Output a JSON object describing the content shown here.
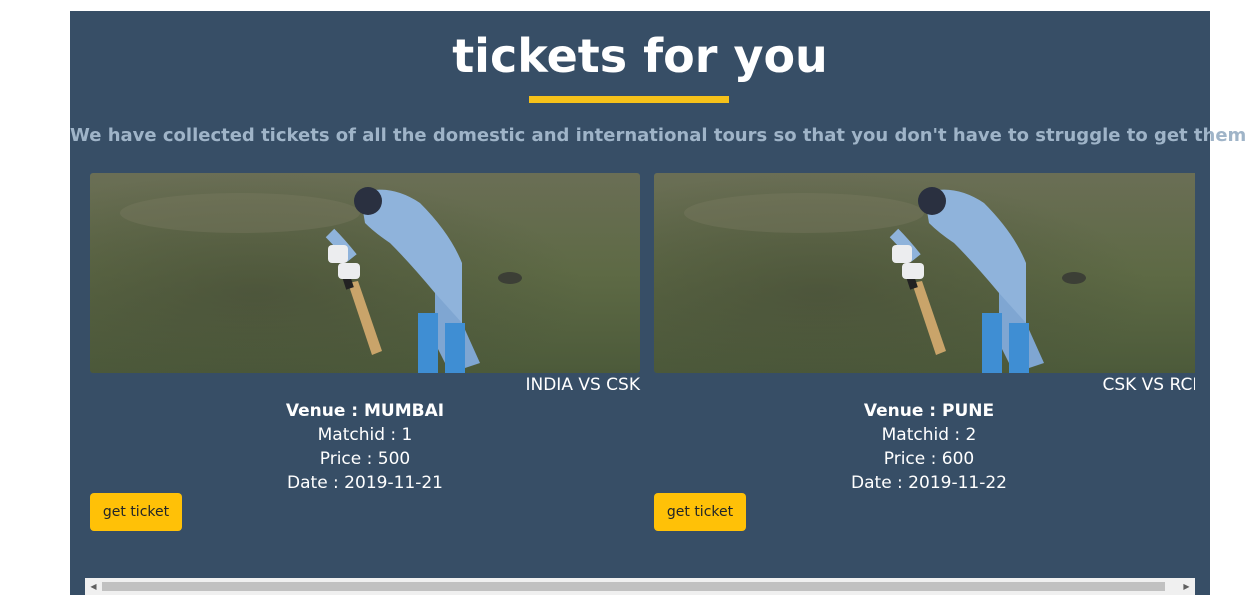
{
  "header": {
    "title": "tickets for you",
    "subtitle": "We have collected tickets of all the domestic and international tours so that you don't have to struggle to get them"
  },
  "tickets": [
    {
      "match": "INDIA VS CSK",
      "venue": "Venue : MUMBAI",
      "matchid": "Matchid : 1",
      "price": "Price : 500",
      "date": "Date : 2019-11-21",
      "button": "get ticket"
    },
    {
      "match": "CSK VS RCB",
      "venue": "Venue : PUNE",
      "matchid": "Matchid : 2",
      "price": "Price : 600",
      "date": "Date : 2019-11-22",
      "button": "get ticket"
    }
  ],
  "colors": {
    "panel_bg": "#374e66",
    "accent": "#f6c21a",
    "button_bg": "#ffc107",
    "subtitle": "#9fb4c8"
  }
}
